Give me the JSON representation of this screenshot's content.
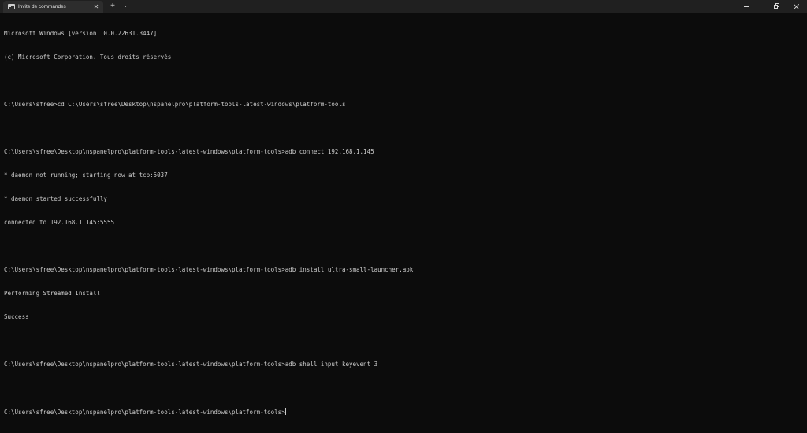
{
  "titlebar": {
    "tab_title": "Invite de commandes",
    "tab_icon": "terminal-icon",
    "close_tab_glyph": "✕",
    "new_tab_glyph": "+",
    "dropdown_glyph": "⌄"
  },
  "console": {
    "lines": [
      "Microsoft Windows [version 10.0.22631.3447]",
      "(c) Microsoft Corporation. Tous droits réservés.",
      "",
      "C:\\Users\\sfree>cd C:\\Users\\sfree\\Desktop\\nspanelpro\\platform-tools-latest-windows\\platform-tools",
      "",
      "C:\\Users\\sfree\\Desktop\\nspanelpro\\platform-tools-latest-windows\\platform-tools>adb connect 192.168.1.145",
      "* daemon not running; starting now at tcp:5037",
      "* daemon started successfully",
      "connected to 192.168.1.145:5555",
      "",
      "C:\\Users\\sfree\\Desktop\\nspanelpro\\platform-tools-latest-windows\\platform-tools>adb install ultra-small-launcher.apk",
      "Performing Streamed Install",
      "Success",
      "",
      "C:\\Users\\sfree\\Desktop\\nspanelpro\\platform-tools-latest-windows\\platform-tools>adb shell input keyevent 3",
      ""
    ],
    "prompt": "C:\\Users\\sfree\\Desktop\\nspanelpro\\platform-tools-latest-windows\\platform-tools>"
  },
  "colors": {
    "background": "#0c0c0c",
    "titlebar": "#202020",
    "active_tab": "#2d2d2d",
    "text": "#cccccc"
  }
}
